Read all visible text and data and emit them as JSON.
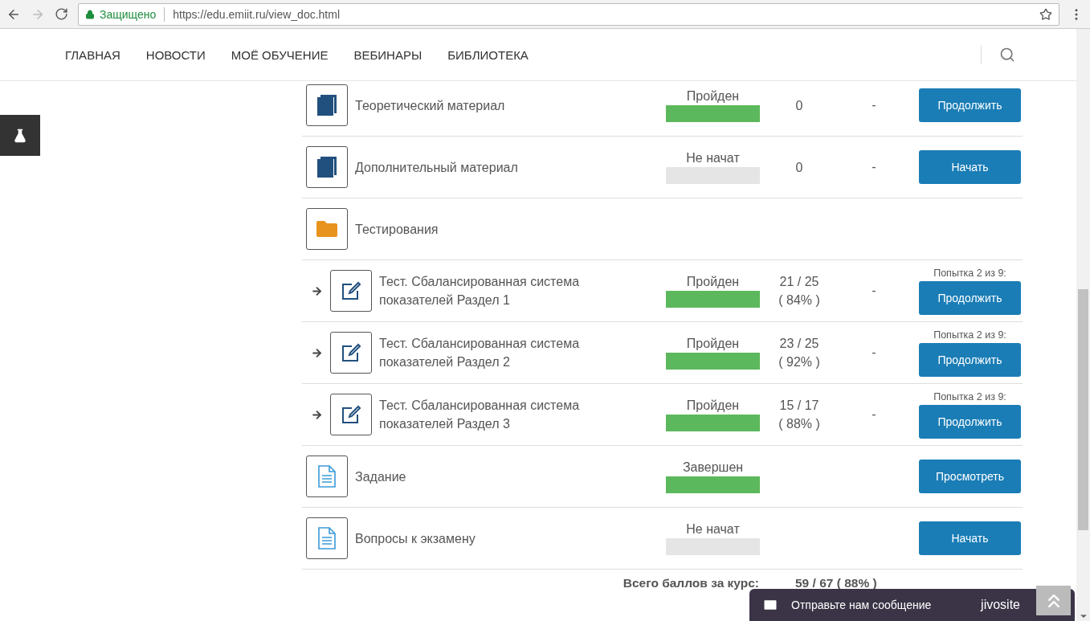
{
  "browser": {
    "security_label": "Защищено",
    "url": "https://edu.emiit.ru/view_doc.html"
  },
  "nav": {
    "items": [
      "ГЛАВНАЯ",
      "НОВОСТИ",
      "МОЁ ОБУЧЕНИЕ",
      "ВЕБИНАРЫ",
      "БИБЛИОТЕКА"
    ]
  },
  "rows": [
    {
      "kind": "book",
      "title": "Теоретический материал",
      "status": "Пройден",
      "level": 1,
      "score": "0",
      "dash": "-",
      "button": "Продолжить"
    },
    {
      "kind": "book",
      "title": "Дополнительный материал",
      "status": "Не начат",
      "level": 0,
      "score": "0",
      "dash": "-",
      "button": "Начать"
    },
    {
      "kind": "folder",
      "title": "Тестирования"
    },
    {
      "kind": "test",
      "title": "Тест. Сбалансированная система показателей Раздел 1",
      "status": "Пройден",
      "level": 1,
      "score": "21 / 25",
      "percent": "( 84% )",
      "dash": "-",
      "attempt": "Попытка 2 из 9:",
      "button": "Продолжить"
    },
    {
      "kind": "test",
      "title": "Тест. Сбалансированная система показателей Раздел 2",
      "status": "Пройден",
      "level": 1,
      "score": "23 / 25",
      "percent": "( 92% )",
      "dash": "-",
      "attempt": "Попытка 2 из 9:",
      "button": "Продолжить"
    },
    {
      "kind": "test",
      "title": "Тест. Сбалансированная система показателей Раздел 3",
      "status": "Пройден",
      "level": 1,
      "score": "15 / 17",
      "percent": "( 88% )",
      "dash": "-",
      "attempt": "Попытка 2 из 9:",
      "button": "Продолжить"
    },
    {
      "kind": "document",
      "title": "Задание",
      "status": "Завершен",
      "level": 1,
      "button": "Просмотреть"
    },
    {
      "kind": "document",
      "title": "Вопросы к экзамену",
      "status": "Не начат",
      "level": 0,
      "button": "Начать"
    }
  ],
  "total": {
    "label": "Всего баллов за курс:",
    "value": "59 / 67 ( 88% )"
  },
  "chat": {
    "text": "Отправьте нам сообщение",
    "brand": "jivosite"
  }
}
